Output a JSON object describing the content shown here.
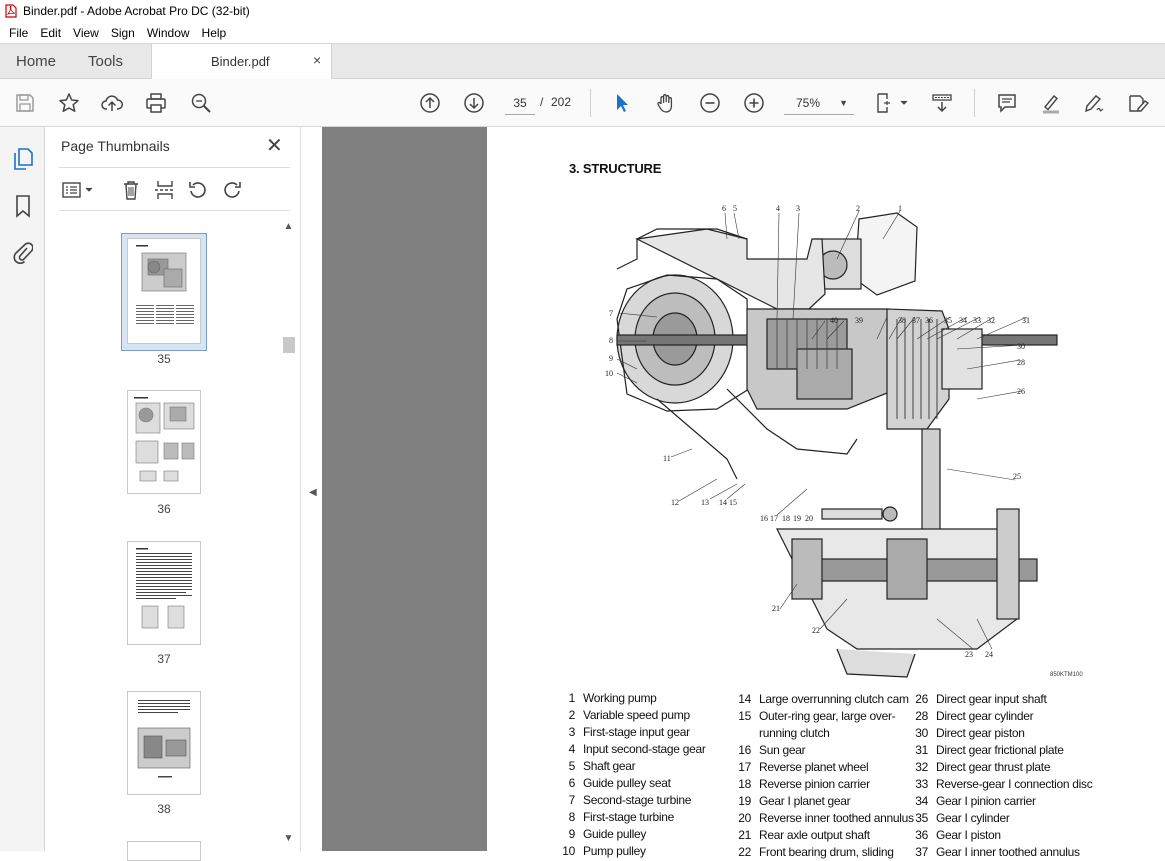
{
  "window": {
    "title": "Binder.pdf - Adobe Acrobat Pro DC (32-bit)",
    "icon": "pdf-file-icon"
  },
  "menu": [
    "File",
    "Edit",
    "View",
    "Sign",
    "Window",
    "Help"
  ],
  "tabs": {
    "home": "Home",
    "tools": "Tools",
    "document": "Binder.pdf",
    "close": "×"
  },
  "toolbar": {
    "page_current": "35",
    "page_separator": "/",
    "page_total": "202",
    "zoom": "75%",
    "icons": [
      "save-icon",
      "bookmark-star-icon",
      "upload-icon",
      "print-icon",
      "search-zoom-icon",
      "previous-page-icon",
      "next-page-icon",
      "select-cursor-icon",
      "hand-icon",
      "zoom-out-icon",
      "zoom-in-icon",
      "page-fit-icon",
      "scroll-mode-icon",
      "comment-icon",
      "highlight-icon",
      "sign-icon",
      "fill-sign-icon"
    ]
  },
  "sidebar": {
    "title": "Page Thumbnails",
    "close": "✕",
    "thumbnails": [
      {
        "page": "35",
        "selected": true
      },
      {
        "page": "36",
        "selected": false
      },
      {
        "page": "37",
        "selected": false
      },
      {
        "page": "38",
        "selected": false
      }
    ]
  },
  "document": {
    "heading": "3. STRUCTURE",
    "figure_code": "850KTM100",
    "callouts": [
      "1",
      "2",
      "3",
      "4",
      "5",
      "6",
      "7",
      "8",
      "9",
      "10",
      "11",
      "12",
      "13",
      "14",
      "15",
      "16",
      "17",
      "18",
      "19",
      "20",
      "21",
      "22",
      "23",
      "24",
      "25",
      "26",
      "28",
      "30",
      "31",
      "32",
      "33",
      "34",
      "35",
      "36",
      "37",
      "38",
      "39",
      "40"
    ],
    "legend": {
      "col1": [
        {
          "n": "1",
          "t": "Working pump"
        },
        {
          "n": "2",
          "t": "Variable speed pump"
        },
        {
          "n": "3",
          "t": "First-stage input gear"
        },
        {
          "n": "4",
          "t": "Input second-stage gear"
        },
        {
          "n": "5",
          "t": "Shaft gear"
        },
        {
          "n": "6",
          "t": "Guide pulley seat"
        },
        {
          "n": "7",
          "t": "Second-stage turbine"
        },
        {
          "n": "8",
          "t": "First-stage turbine"
        },
        {
          "n": "9",
          "t": "Guide pulley"
        },
        {
          "n": "10",
          "t": "Pump pulley"
        }
      ],
      "col2": [
        {
          "n": "14",
          "t": "Large overrunning clutch cam"
        },
        {
          "n": "15",
          "t": "Outer-ring gear, large over-"
        },
        {
          "n": "",
          "t": "running clutch"
        },
        {
          "n": "16",
          "t": "Sun gear"
        },
        {
          "n": "17",
          "t": "Reverse planet wheel"
        },
        {
          "n": "18",
          "t": "Reverse pinion carrier"
        },
        {
          "n": "19",
          "t": "Gear I planet gear"
        },
        {
          "n": "20",
          "t": "Reverse inner toothed annulus"
        },
        {
          "n": "21",
          "t": "Rear axle output shaft"
        },
        {
          "n": "22",
          "t": "Front bearing drum, sliding"
        }
      ],
      "col3": [
        {
          "n": "26",
          "t": "Direct gear input shaft"
        },
        {
          "n": "28",
          "t": "Direct gear cylinder"
        },
        {
          "n": "30",
          "t": "Direct gear piston"
        },
        {
          "n": "31",
          "t": "Direct gear frictional plate"
        },
        {
          "n": "32",
          "t": "Direct gear thrust plate"
        },
        {
          "n": "33",
          "t": "Reverse-gear I connection disc"
        },
        {
          "n": "34",
          "t": "Gear I pinion carrier"
        },
        {
          "n": "35",
          "t": "Gear I cylinder"
        },
        {
          "n": "36",
          "t": "Gear I piston"
        },
        {
          "n": "37",
          "t": "Gear I inner toothed annulus"
        }
      ]
    }
  }
}
